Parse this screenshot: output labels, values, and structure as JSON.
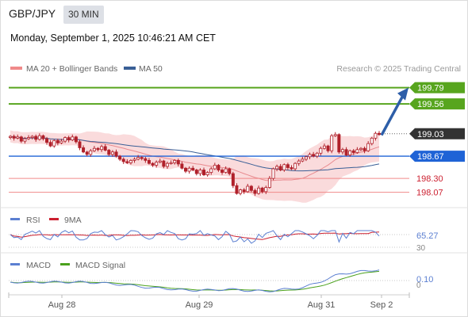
{
  "header": {
    "pair": "GBP/JPY",
    "timeframe": "30 MIN",
    "datetime": "Monday, September 1, 2025 10:46:21 AM CET"
  },
  "legend": {
    "ma20_bb": "MA 20 + Bollinger Bands",
    "ma50": "MA 50",
    "research": "Research © 2025 Trading Central",
    "rsi": "RSI",
    "rsi_ma": "9MA",
    "macd": "MACD",
    "macd_signal": "MACD Signal"
  },
  "colors": {
    "candle": "#b0202a",
    "bollinger_fill": "#f9d5d6",
    "ma20": "#e88a8f",
    "ma50": "#3a5f96",
    "resistance": "#57a51e",
    "pivot": "#1f63d6",
    "support": "#f08a8a",
    "current_price_tag": "#333333",
    "rsi_line": "#5b7fd1",
    "rsi_ma_line": "#cc1f2f",
    "macd_line": "#5b7fd1",
    "macd_signal_line": "#4aa11c"
  },
  "chart_data": {
    "type": "candlestick",
    "x_ticks": [
      "Aug 28",
      "Aug 29",
      "Aug 31",
      "Sep 2"
    ],
    "y_range": [
      197.88,
      199.95
    ],
    "current_price": "199.03",
    "levels": [
      {
        "value": 199.79,
        "label": "199.79",
        "kind": "resistance"
      },
      {
        "value": 199.56,
        "label": "199.56",
        "kind": "resistance"
      },
      {
        "value": 198.67,
        "label": "198.67",
        "kind": "pivot"
      },
      {
        "value": 198.3,
        "label": "198.30",
        "kind": "support"
      },
      {
        "value": 198.07,
        "label": "198.07",
        "kind": "support"
      }
    ],
    "target_arrow": {
      "from": 199.02,
      "to": 199.77
    },
    "closes": [
      199.0,
      198.97,
      198.99,
      198.92,
      198.96,
      198.98,
      199.0,
      198.95,
      199.01,
      198.96,
      198.9,
      198.84,
      198.93,
      198.89,
      198.92,
      198.98,
      198.94,
      198.99,
      198.91,
      198.81,
      198.74,
      198.7,
      198.76,
      198.8,
      198.78,
      198.83,
      198.77,
      198.7,
      198.74,
      198.67,
      198.62,
      198.58,
      198.56,
      198.6,
      198.62,
      198.65,
      198.63,
      198.6,
      198.55,
      198.52,
      198.57,
      198.59,
      198.5,
      198.55,
      198.56,
      198.6,
      198.54,
      198.47,
      198.42,
      198.47,
      198.44,
      198.38,
      198.44,
      198.36,
      198.4,
      198.46,
      198.52,
      198.44,
      198.4,
      198.46,
      198.38,
      198.18,
      198.05,
      198.11,
      198.08,
      198.17,
      198.1,
      198.05,
      198.14,
      198.08,
      198.15,
      198.3,
      198.46,
      198.5,
      198.44,
      198.53,
      198.48,
      198.46,
      198.55,
      198.59,
      198.62,
      198.66,
      198.7,
      198.67,
      198.72,
      198.8,
      198.84,
      198.76,
      199.01,
      199.03,
      198.74,
      198.78,
      198.69,
      198.76,
      198.73,
      198.78,
      198.8,
      198.76,
      198.88,
      198.97,
      199.05,
      199.03
    ],
    "rsi": {
      "value_label": "65.27",
      "ticks": [
        "30"
      ]
    },
    "macd": {
      "value_label": "0.10",
      "ticks": [
        "0"
      ]
    }
  }
}
